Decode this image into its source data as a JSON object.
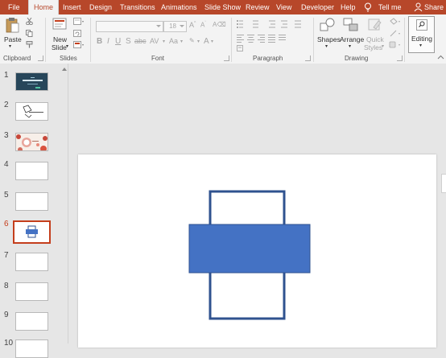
{
  "tabs": {
    "file": "File",
    "home": "Home",
    "insert": "Insert",
    "design": "Design",
    "transitions": "Transitions",
    "animations": "Animations",
    "slideshow": "Slide Show",
    "review": "Review",
    "view": "View",
    "developer": "Developer",
    "help": "Help",
    "tellme": "Tell me",
    "share": "Share"
  },
  "ribbon": {
    "clipboard": {
      "paste": "Paste",
      "label": "Clipboard"
    },
    "slides": {
      "new_slide_line1": "New",
      "new_slide_line2": "Slide",
      "label": "Slides"
    },
    "font": {
      "size_value": "18",
      "label": "Font"
    },
    "paragraph": {
      "label": "Paragraph"
    },
    "drawing": {
      "shapes": "Shapes",
      "arrange": "Arrange",
      "quick_styles_line1": "Quick",
      "quick_styles_line2": "Styles",
      "label": "Drawing"
    },
    "editing": {
      "label": "Editing"
    }
  },
  "slides": {
    "numbers": [
      "1",
      "2",
      "3",
      "4",
      "5",
      "6",
      "7",
      "8",
      "9",
      "10"
    ],
    "selected": "6"
  },
  "colors": {
    "accent": "#b7472a",
    "selection": "#c43e1c",
    "shape_fill": "#4472c4",
    "shape_stroke": "#2f528f"
  }
}
